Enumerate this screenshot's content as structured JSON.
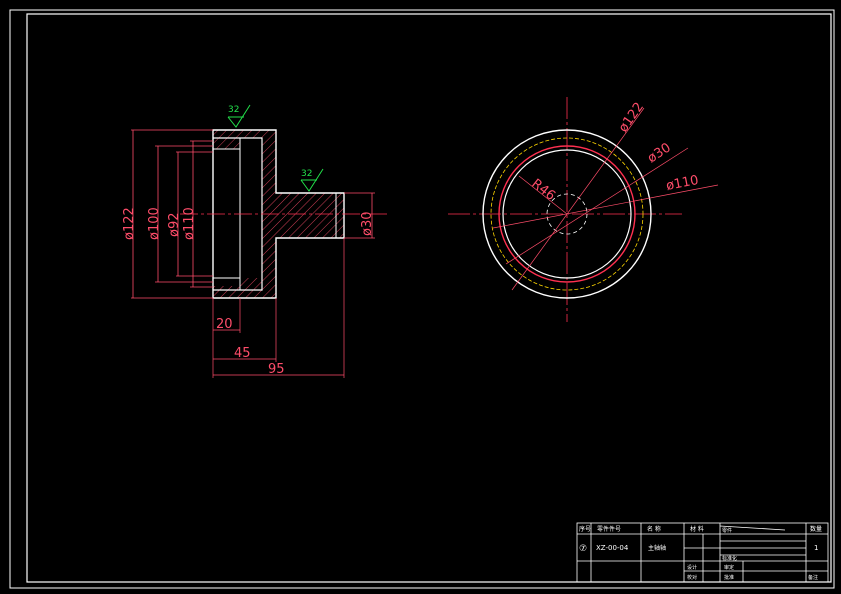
{
  "front_view": {
    "roughness_top": "32",
    "roughness_shaft": "32",
    "dims": {
      "d122": "ø122",
      "d100": "ø100",
      "d92": "ø92",
      "d110": "ø110",
      "d30": "ø30",
      "len20": "20",
      "len45": "45",
      "len95": "95"
    }
  },
  "side_view": {
    "dims": {
      "d122": "ø122",
      "d30": "ø30",
      "d110": "ø110",
      "r46": "R46"
    }
  },
  "title_block": {
    "headers": [
      "序号",
      "零件件号",
      "名 称",
      "材 料",
      "",
      "",
      "数量"
    ],
    "row": {
      "index": "⑦",
      "part_no": "XZ-00-04",
      "name": "主轴轴",
      "qty": "1"
    },
    "sign_labels": [
      "设计",
      "审定",
      "校对",
      "批准",
      "标准化",
      "零件",
      "备注"
    ]
  },
  "colors": {
    "outline": "#ffffff",
    "dimension": "#ff4d6a",
    "roughness": "#22e04a",
    "centerline": "#ff3050",
    "hidden": "#ffd700"
  }
}
